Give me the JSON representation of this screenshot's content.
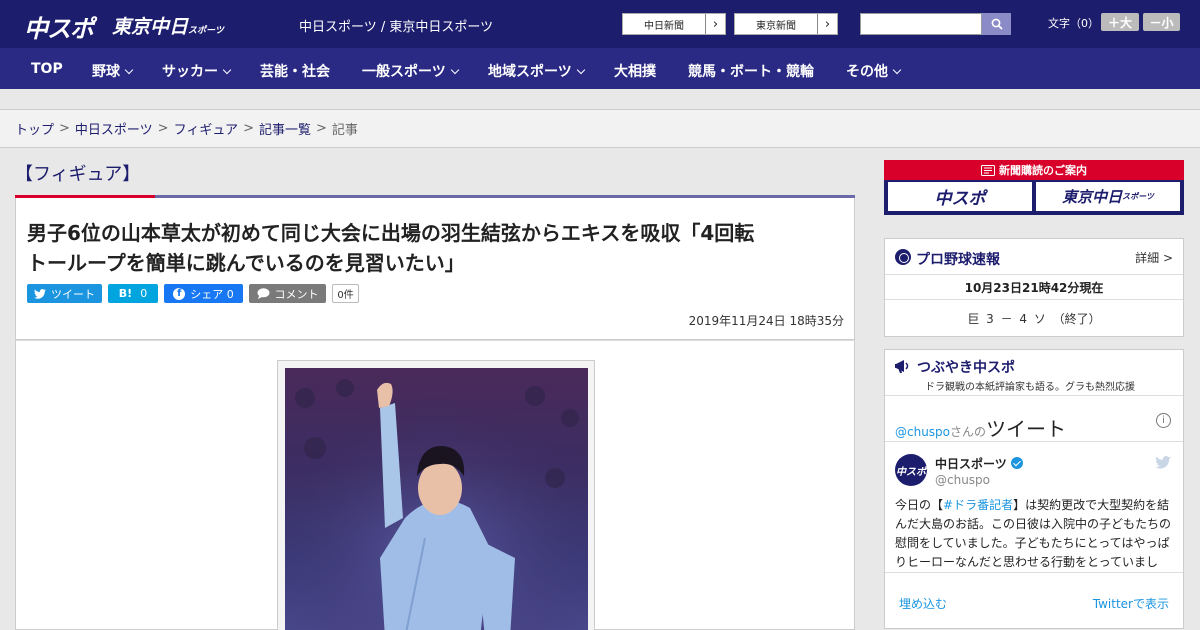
{
  "header": {
    "logo_chuspo": "中スポ",
    "logo_tokyo": "東京中日",
    "logo_tokyo_small": "スポーツ",
    "site_title": "中日スポーツ / 東京中日スポーツ",
    "btn_chunichi": "中日新聞",
    "btn_tokyo": "東京新聞",
    "btn_arrow": "›",
    "font_label": "文字（0）",
    "font_large": "＋大",
    "font_small": "－小",
    "search_placeholder": ""
  },
  "nav": {
    "items": [
      {
        "label": "TOP",
        "dropdown": false
      },
      {
        "label": "野球",
        "dropdown": true
      },
      {
        "label": "サッカー",
        "dropdown": true
      },
      {
        "label": "芸能・社会",
        "dropdown": false
      },
      {
        "label": "一般スポーツ",
        "dropdown": true
      },
      {
        "label": "地域スポーツ",
        "dropdown": true
      },
      {
        "label": "大相撲",
        "dropdown": false
      },
      {
        "label": "競馬・ボート・競輪",
        "dropdown": false
      },
      {
        "label": "その他",
        "dropdown": true
      }
    ]
  },
  "breadcrumb": {
    "items": [
      "トップ",
      "中日スポーツ",
      "フィギュア",
      "記事一覧",
      "記事"
    ],
    "separator": ">"
  },
  "article": {
    "category": "【フィギュア】",
    "headline_line1": "男子6位の山本草太が初めて同じ大会に出場の羽生結弦からエキスを吸収「4回転",
    "headline_line2": "トーループを簡単に跳んでいるのを見習いたい」",
    "share_tweet": "ツイート",
    "share_hatena": "0",
    "share_facebook": "シェア 0",
    "share_comment": "コメント",
    "share_comment_count": "0件",
    "date": "2019年11月24日 18時35分"
  },
  "sidebar": {
    "subscription_title": "新聞購読のご案内",
    "sub_logo_chuspo": "中スポ",
    "sub_logo_tokyo": "東京中日",
    "sub_logo_tokyo_small": "スポーツ",
    "baseball_title": "プロ野球速報",
    "baseball_detail": "詳細 >",
    "baseball_time": "10月23日21時42分現在",
    "baseball_score": "巨 3 － 4 ソ （終了）",
    "tweets_title": "つぶやき中スポ",
    "tweets_subtitle": "ドラ観戦の本紙評論家も語る。グラも熱烈応援",
    "tweet_handle_link": "@chuspo",
    "tweet_san": "さんの",
    "tweet_word": "ツイート",
    "tweet_author": "中日スポーツ",
    "tweet_at": "@chuspo",
    "tweet_avatar": "中スポ",
    "tweet_text_prefix": "今日の【",
    "tweet_hashtag": "#ドラ番記者",
    "tweet_text_body": "】は契約更改で大型契約を結んだ大島のお話。この日彼は入院中の子どもたちの慰問をしていました。子どもたちにとってはやっぱりヒーローなんだと思わせる行動をとっていまし",
    "tweet_embed": "埋め込む",
    "tweet_view": "Twitterで表示"
  }
}
